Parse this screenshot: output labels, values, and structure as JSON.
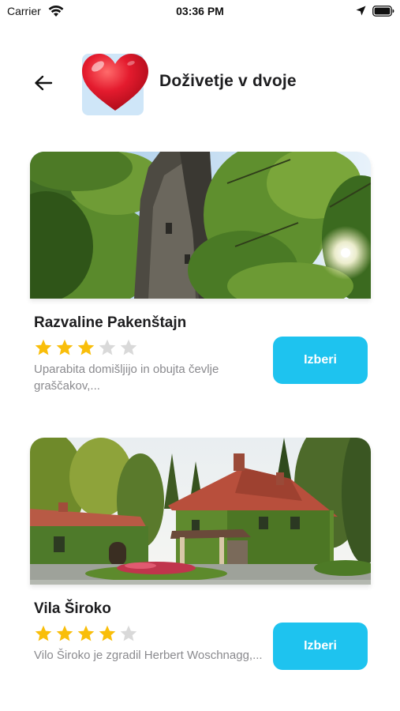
{
  "status_bar": {
    "carrier": "Carrier",
    "time": "03:36 PM",
    "icons": [
      "wifi-icon",
      "location-arrow-icon",
      "battery-icon"
    ]
  },
  "header": {
    "back_icon": "arrow-left-icon",
    "category_icon": "red-heart-icon",
    "title": "Doživetje v dvoje"
  },
  "places": [
    {
      "name": "Razvaline Pakenštajn",
      "rating": 3,
      "rating_max": 5,
      "description": "Uparabita domišljijo in obujta čevlje graščakov,...",
      "button_label": "Izberi",
      "image": "castle-ruins-forest-photo"
    },
    {
      "name": "Vila Široko",
      "rating": 4,
      "rating_max": 5,
      "description": "Vilo Široko je zgradil Herbert Woschnagg,...",
      "button_label": "Izberi",
      "image": "ivy-covered-villa-photo"
    }
  ],
  "colors": {
    "accent": "#1ec3ef",
    "star_filled": "#f9be0a",
    "star_empty": "#d9d9d9",
    "text_primary": "#1d1d1f",
    "text_secondary": "#8a8a8e",
    "heart": "#e0142a"
  }
}
